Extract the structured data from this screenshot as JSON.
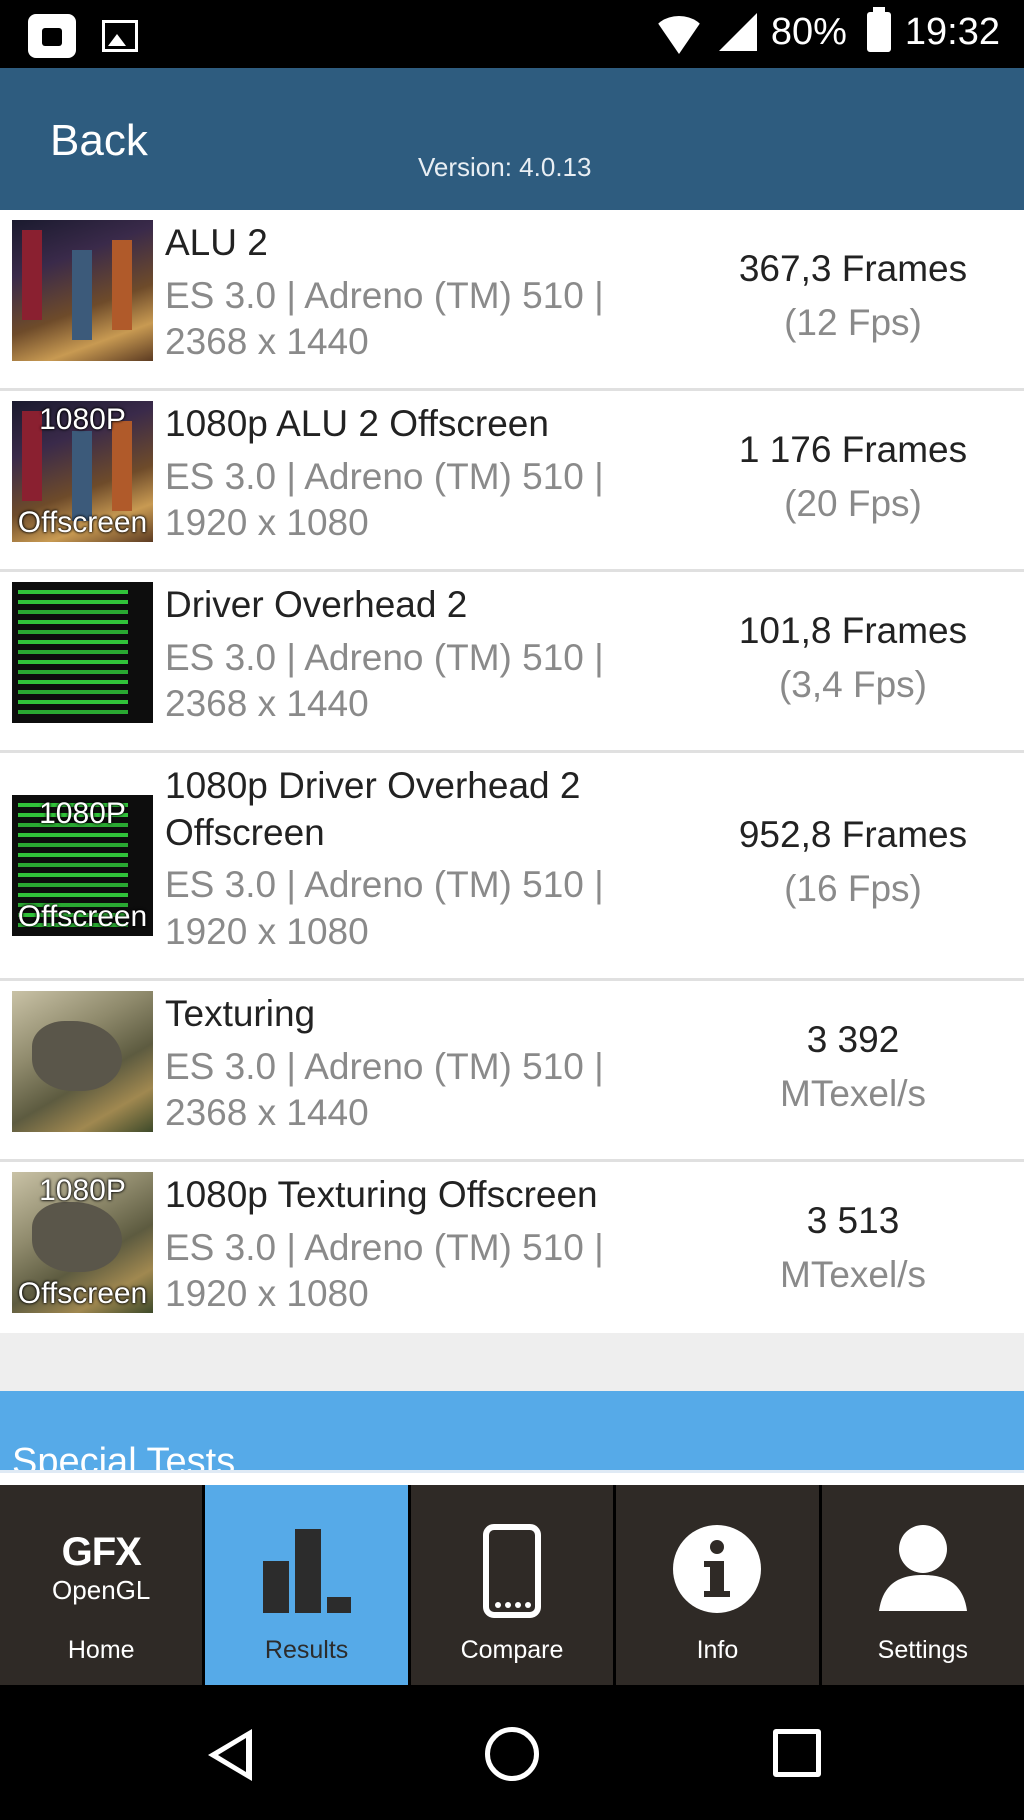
{
  "status_bar": {
    "battery": "80%",
    "time": "19:32",
    "icons": [
      "briefcase-icon",
      "image-icon",
      "wifi-icon",
      "signal-icon",
      "battery-icon"
    ]
  },
  "header": {
    "back_label": "Back",
    "version": "Version: 4.0.13"
  },
  "results": [
    {
      "title": "ALU 2",
      "line1": "ES 3.0 | Adreno (TM) 510 |",
      "line2": "2368 x 1440",
      "score": "367,3 Frames",
      "unit": "(12 Fps)",
      "thumb_tag_top": "",
      "thumb_tag_bottom": ""
    },
    {
      "title": "1080p ALU 2 Offscreen",
      "line1": "ES 3.0 | Adreno (TM) 510 |",
      "line2": "1920 x 1080",
      "score": "1 176 Frames",
      "unit": "(20 Fps)",
      "thumb_tag_top": "1080P",
      "thumb_tag_bottom": "Offscreen"
    },
    {
      "title": "Driver Overhead 2",
      "line1": "ES 3.0 | Adreno (TM) 510 |",
      "line2": "2368 x 1440",
      "score": "101,8 Frames",
      "unit": "(3,4 Fps)",
      "thumb_tag_top": "",
      "thumb_tag_bottom": ""
    },
    {
      "title": "1080p Driver Overhead 2",
      "title2": "Offscreen",
      "line1": "ES 3.0 | Adreno (TM) 510 |",
      "line2": "1920 x 1080",
      "score": "952,8 Frames",
      "unit": "(16 Fps)",
      "thumb_tag_top": "1080P",
      "thumb_tag_bottom": "Offscreen"
    },
    {
      "title": "Texturing",
      "line1": "ES 3.0 | Adreno (TM) 510 |",
      "line2": "2368 x 1440",
      "score": "3 392",
      "unit": "MTexel/s",
      "thumb_tag_top": "",
      "thumb_tag_bottom": ""
    },
    {
      "title": "1080p Texturing Offscreen",
      "line1": "ES 3.0 | Adreno (TM) 510 |",
      "line2": "1920 x 1080",
      "score": "3 513",
      "unit": "MTexel/s",
      "thumb_tag_top": "1080P",
      "thumb_tag_bottom": "Offscreen"
    }
  ],
  "special_tests_label": "Special Tests",
  "nav": {
    "home": {
      "logo_main": "GFX",
      "logo_sub": "OpenGL",
      "label": "Home"
    },
    "results": {
      "label": "Results"
    },
    "compare": {
      "label": "Compare"
    },
    "info": {
      "label": "Info"
    },
    "settings": {
      "label": "Settings"
    },
    "active": "results"
  },
  "colors": {
    "header_bg": "#2e5c7f",
    "accent_blue": "#56aae8",
    "nav_bg": "#2f2a26"
  }
}
